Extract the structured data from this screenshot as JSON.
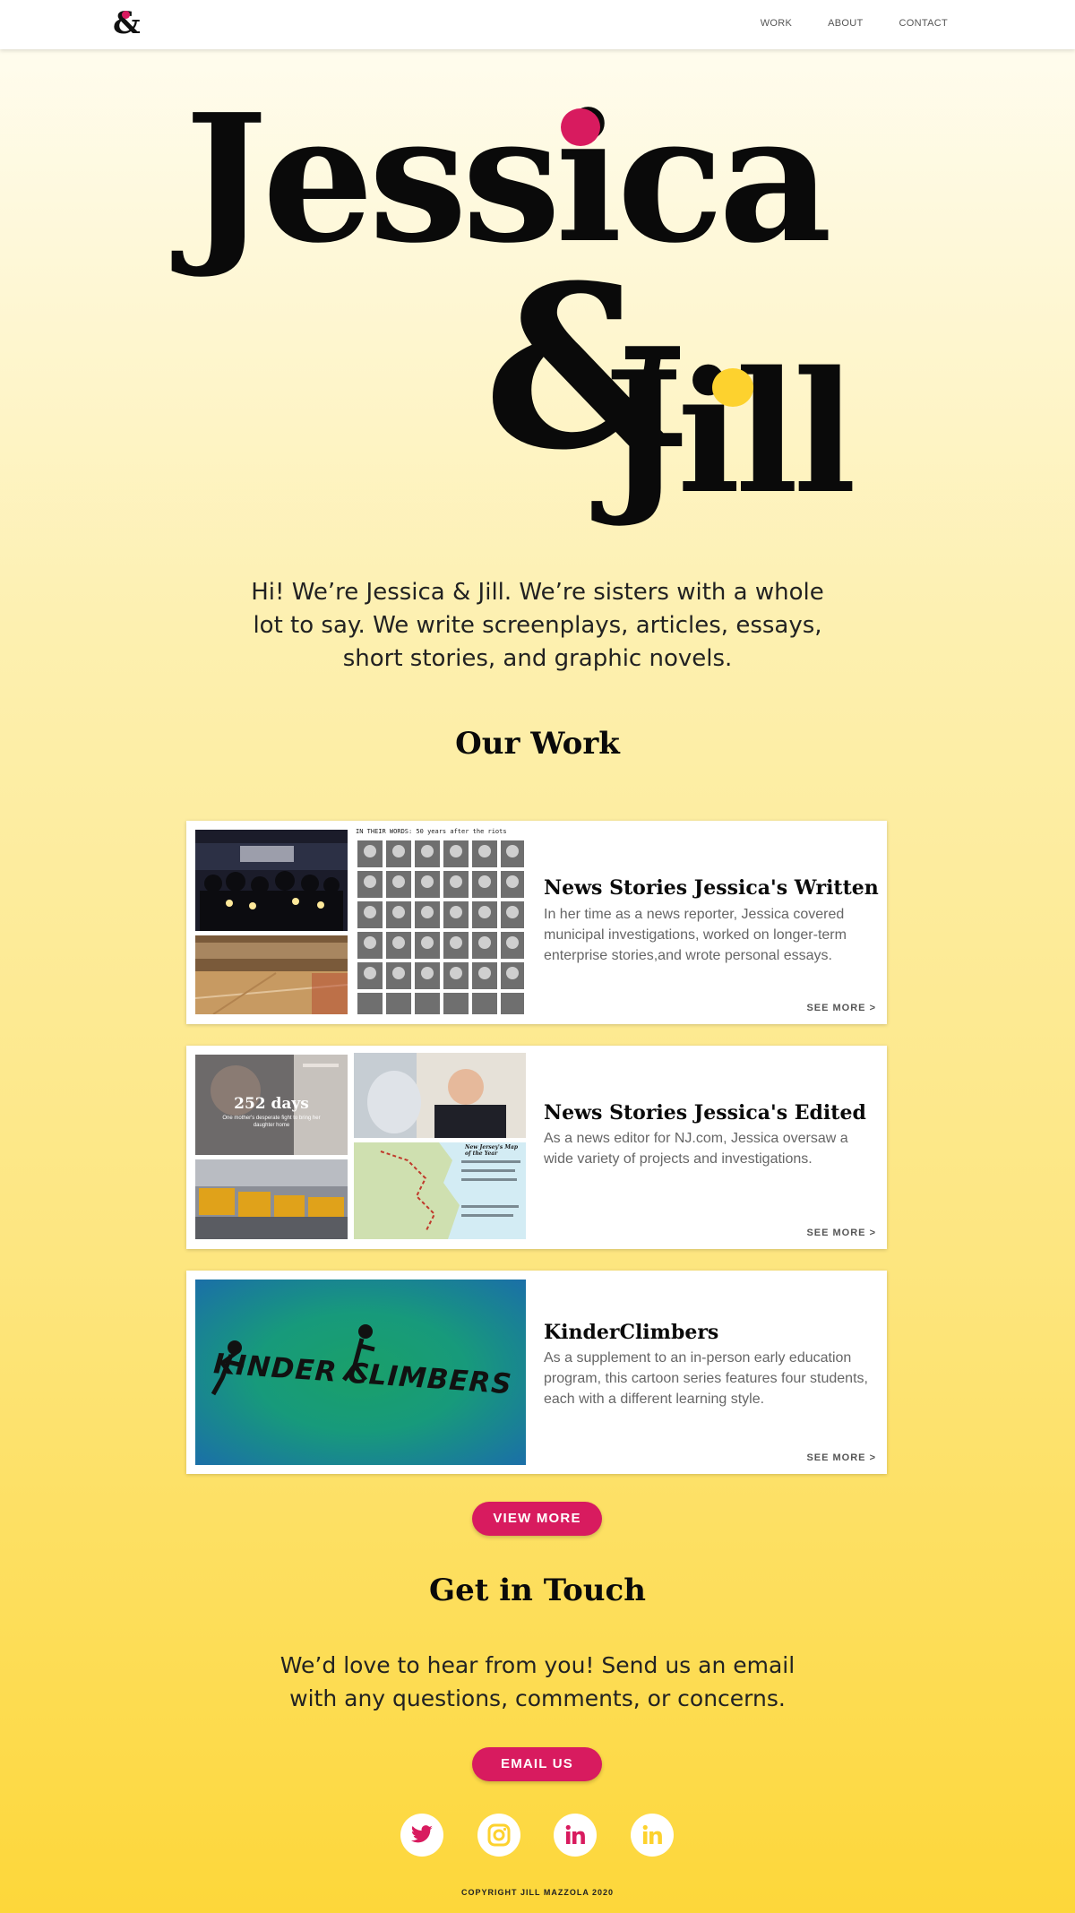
{
  "nav": {
    "logo": "&",
    "links": [
      "WORK",
      "ABOUT",
      "CONTACT"
    ]
  },
  "hero": {
    "line1": "Jessica",
    "amp": "&",
    "line2": "Jill"
  },
  "intro": "Hi! We’re Jessica & Jill. We’re sisters with a whole lot to say. We write screenplays, articles, essays, short stories, and graphic novels.",
  "work": {
    "title": "Our Work",
    "cards": [
      {
        "title": "News Stories Jessica's Written",
        "description": "In her time as a news reporter, Jessica covered municipal investigations, worked on longer-term enterprise stories,and wrote personal essays.",
        "see_more": "SEE MORE >",
        "collage_caption": "IN THEIR WORDS: 50 years after the riots"
      },
      {
        "title": "News Stories Jessica's Edited",
        "description": "As a news editor for NJ.com, Jessica oversaw a wide variety of projects and investigations.",
        "see_more": "SEE MORE >",
        "thumb_headline": "252 days",
        "thumb_subhead": "One mother's desperate fight to bring her daughter home",
        "map_title": "New Jersey's Map of the Year"
      },
      {
        "title": "KinderClimbers",
        "description": "As a supplement to an in-person early education program, this cartoon series features four students, each with a different learning style.",
        "see_more": "SEE MORE >",
        "logo_text": "KINDER CLIMBERS"
      }
    ],
    "view_more": "VIEW MORE"
  },
  "contact": {
    "title": "Get in Touch",
    "text": "We’d love to hear from you! Send us an email with any questions, comments, or concerns.",
    "button": "EMAIL US"
  },
  "social": [
    "twitter-icon",
    "instagram-icon",
    "linkedin-icon",
    "linkedin-icon"
  ],
  "colors": {
    "accent": "#d81b5f",
    "yellow": "#fdd22e"
  },
  "copyright": "COPYRIGHT JILL MAZZOLA 2020"
}
